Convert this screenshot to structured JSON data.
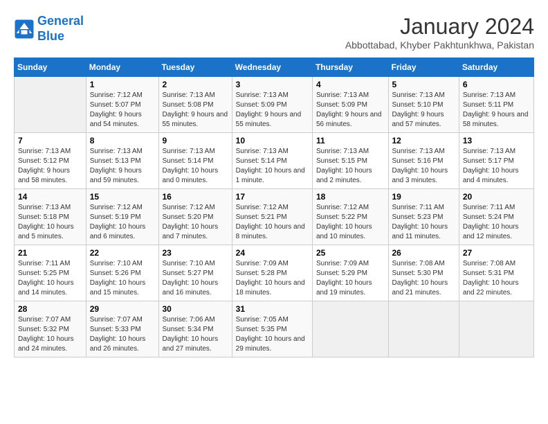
{
  "logo": {
    "line1": "General",
    "line2": "Blue"
  },
  "title": "January 2024",
  "location": "Abbottabad, Khyber Pakhtunkhwa, Pakistan",
  "headers": [
    "Sunday",
    "Monday",
    "Tuesday",
    "Wednesday",
    "Thursday",
    "Friday",
    "Saturday"
  ],
  "weeks": [
    [
      {
        "day": "",
        "sunrise": "",
        "sunset": "",
        "daylight": ""
      },
      {
        "day": "1",
        "sunrise": "Sunrise: 7:12 AM",
        "sunset": "Sunset: 5:07 PM",
        "daylight": "Daylight: 9 hours and 54 minutes."
      },
      {
        "day": "2",
        "sunrise": "Sunrise: 7:13 AM",
        "sunset": "Sunset: 5:08 PM",
        "daylight": "Daylight: 9 hours and 55 minutes."
      },
      {
        "day": "3",
        "sunrise": "Sunrise: 7:13 AM",
        "sunset": "Sunset: 5:09 PM",
        "daylight": "Daylight: 9 hours and 55 minutes."
      },
      {
        "day": "4",
        "sunrise": "Sunrise: 7:13 AM",
        "sunset": "Sunset: 5:09 PM",
        "daylight": "Daylight: 9 hours and 56 minutes."
      },
      {
        "day": "5",
        "sunrise": "Sunrise: 7:13 AM",
        "sunset": "Sunset: 5:10 PM",
        "daylight": "Daylight: 9 hours and 57 minutes."
      },
      {
        "day": "6",
        "sunrise": "Sunrise: 7:13 AM",
        "sunset": "Sunset: 5:11 PM",
        "daylight": "Daylight: 9 hours and 58 minutes."
      }
    ],
    [
      {
        "day": "7",
        "sunrise": "Sunrise: 7:13 AM",
        "sunset": "Sunset: 5:12 PM",
        "daylight": "Daylight: 9 hours and 58 minutes."
      },
      {
        "day": "8",
        "sunrise": "Sunrise: 7:13 AM",
        "sunset": "Sunset: 5:13 PM",
        "daylight": "Daylight: 9 hours and 59 minutes."
      },
      {
        "day": "9",
        "sunrise": "Sunrise: 7:13 AM",
        "sunset": "Sunset: 5:14 PM",
        "daylight": "Daylight: 10 hours and 0 minutes."
      },
      {
        "day": "10",
        "sunrise": "Sunrise: 7:13 AM",
        "sunset": "Sunset: 5:14 PM",
        "daylight": "Daylight: 10 hours and 1 minute."
      },
      {
        "day": "11",
        "sunrise": "Sunrise: 7:13 AM",
        "sunset": "Sunset: 5:15 PM",
        "daylight": "Daylight: 10 hours and 2 minutes."
      },
      {
        "day": "12",
        "sunrise": "Sunrise: 7:13 AM",
        "sunset": "Sunset: 5:16 PM",
        "daylight": "Daylight: 10 hours and 3 minutes."
      },
      {
        "day": "13",
        "sunrise": "Sunrise: 7:13 AM",
        "sunset": "Sunset: 5:17 PM",
        "daylight": "Daylight: 10 hours and 4 minutes."
      }
    ],
    [
      {
        "day": "14",
        "sunrise": "Sunrise: 7:13 AM",
        "sunset": "Sunset: 5:18 PM",
        "daylight": "Daylight: 10 hours and 5 minutes."
      },
      {
        "day": "15",
        "sunrise": "Sunrise: 7:12 AM",
        "sunset": "Sunset: 5:19 PM",
        "daylight": "Daylight: 10 hours and 6 minutes."
      },
      {
        "day": "16",
        "sunrise": "Sunrise: 7:12 AM",
        "sunset": "Sunset: 5:20 PM",
        "daylight": "Daylight: 10 hours and 7 minutes."
      },
      {
        "day": "17",
        "sunrise": "Sunrise: 7:12 AM",
        "sunset": "Sunset: 5:21 PM",
        "daylight": "Daylight: 10 hours and 8 minutes."
      },
      {
        "day": "18",
        "sunrise": "Sunrise: 7:12 AM",
        "sunset": "Sunset: 5:22 PM",
        "daylight": "Daylight: 10 hours and 10 minutes."
      },
      {
        "day": "19",
        "sunrise": "Sunrise: 7:11 AM",
        "sunset": "Sunset: 5:23 PM",
        "daylight": "Daylight: 10 hours and 11 minutes."
      },
      {
        "day": "20",
        "sunrise": "Sunrise: 7:11 AM",
        "sunset": "Sunset: 5:24 PM",
        "daylight": "Daylight: 10 hours and 12 minutes."
      }
    ],
    [
      {
        "day": "21",
        "sunrise": "Sunrise: 7:11 AM",
        "sunset": "Sunset: 5:25 PM",
        "daylight": "Daylight: 10 hours and 14 minutes."
      },
      {
        "day": "22",
        "sunrise": "Sunrise: 7:10 AM",
        "sunset": "Sunset: 5:26 PM",
        "daylight": "Daylight: 10 hours and 15 minutes."
      },
      {
        "day": "23",
        "sunrise": "Sunrise: 7:10 AM",
        "sunset": "Sunset: 5:27 PM",
        "daylight": "Daylight: 10 hours and 16 minutes."
      },
      {
        "day": "24",
        "sunrise": "Sunrise: 7:09 AM",
        "sunset": "Sunset: 5:28 PM",
        "daylight": "Daylight: 10 hours and 18 minutes."
      },
      {
        "day": "25",
        "sunrise": "Sunrise: 7:09 AM",
        "sunset": "Sunset: 5:29 PM",
        "daylight": "Daylight: 10 hours and 19 minutes."
      },
      {
        "day": "26",
        "sunrise": "Sunrise: 7:08 AM",
        "sunset": "Sunset: 5:30 PM",
        "daylight": "Daylight: 10 hours and 21 minutes."
      },
      {
        "day": "27",
        "sunrise": "Sunrise: 7:08 AM",
        "sunset": "Sunset: 5:31 PM",
        "daylight": "Daylight: 10 hours and 22 minutes."
      }
    ],
    [
      {
        "day": "28",
        "sunrise": "Sunrise: 7:07 AM",
        "sunset": "Sunset: 5:32 PM",
        "daylight": "Daylight: 10 hours and 24 minutes."
      },
      {
        "day": "29",
        "sunrise": "Sunrise: 7:07 AM",
        "sunset": "Sunset: 5:33 PM",
        "daylight": "Daylight: 10 hours and 26 minutes."
      },
      {
        "day": "30",
        "sunrise": "Sunrise: 7:06 AM",
        "sunset": "Sunset: 5:34 PM",
        "daylight": "Daylight: 10 hours and 27 minutes."
      },
      {
        "day": "31",
        "sunrise": "Sunrise: 7:05 AM",
        "sunset": "Sunset: 5:35 PM",
        "daylight": "Daylight: 10 hours and 29 minutes."
      },
      {
        "day": "",
        "sunrise": "",
        "sunset": "",
        "daylight": ""
      },
      {
        "day": "",
        "sunrise": "",
        "sunset": "",
        "daylight": ""
      },
      {
        "day": "",
        "sunrise": "",
        "sunset": "",
        "daylight": ""
      }
    ]
  ]
}
